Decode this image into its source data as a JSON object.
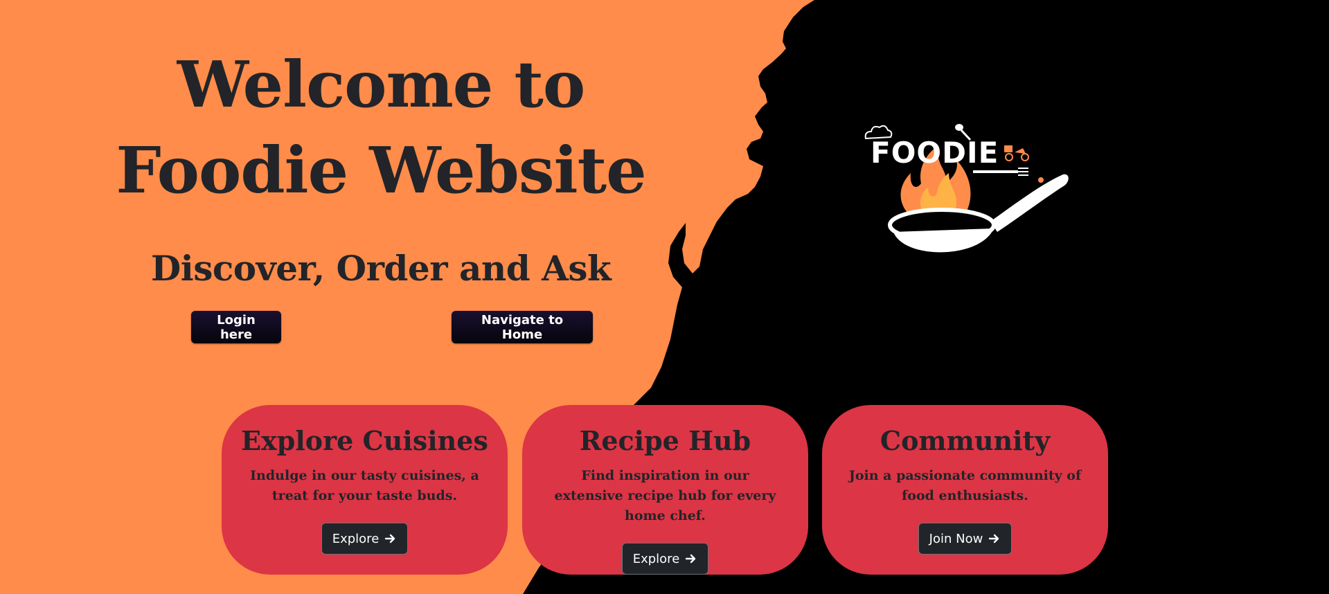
{
  "hero": {
    "title_line1": "Welcome to",
    "title_line2": "Foodie Website",
    "subtitle": "Discover, Order and Ask",
    "login_label": "Login here",
    "home_label": "Navigate to Home"
  },
  "logo": {
    "text": "FOODIE"
  },
  "cards": [
    {
      "title": "Explore Cuisines",
      "text": "Indulge in our tasty cuisines, a treat for your taste buds.",
      "button": "Explore",
      "icon": "arrow-right-icon"
    },
    {
      "title": "Recipe Hub",
      "text": "Find inspiration in our extensive recipe hub for every home chef.",
      "button": "Explore",
      "icon": "arrow-right-icon"
    },
    {
      "title": "Community",
      "text": "Join a passionate community of food enthusiasts.",
      "button": "Join Now",
      "icon": "arrow-right-icon"
    }
  ],
  "colors": {
    "background": "#ff8c4a",
    "silhouette": "#000000",
    "card": "#dc3545",
    "text_dark": "#222429",
    "button_dark": "#212529"
  }
}
